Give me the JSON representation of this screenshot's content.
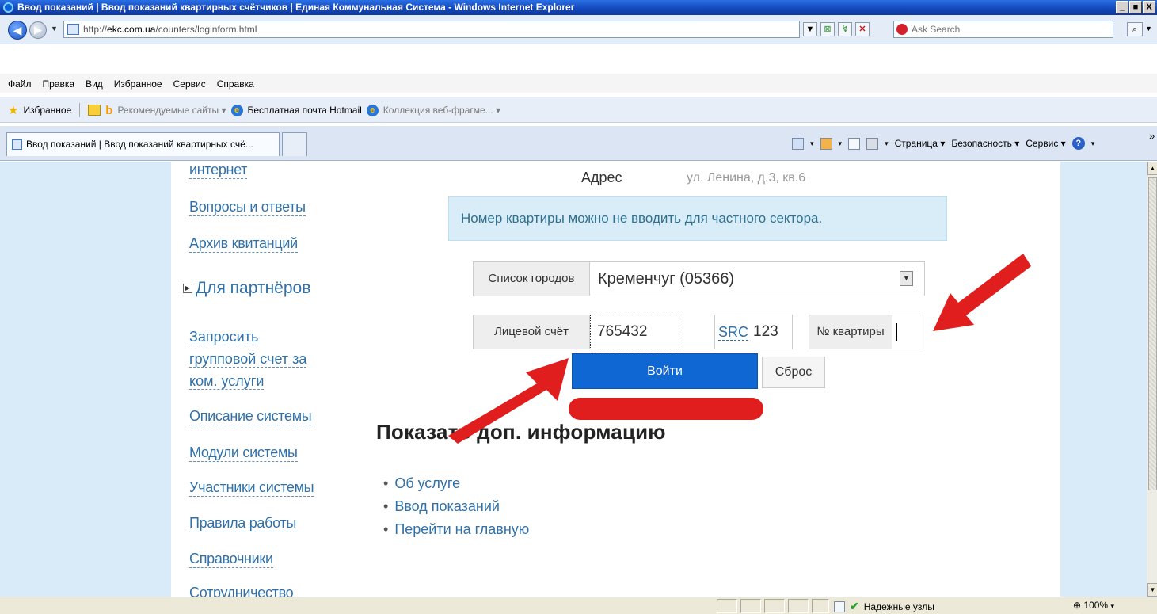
{
  "window": {
    "title": "Ввод показаний | Ввод показаний квартирных счётчиков | Единая Коммунальная Система - Windows Internet Explorer",
    "controls": [
      "_",
      "■",
      "X"
    ]
  },
  "address": {
    "url_prefix": "http://",
    "url_domain": "ekc.com.ua",
    "url_path": "/counters/loginform.html",
    "search_placeholder": "Ask Search"
  },
  "menu": [
    "Файл",
    "Правка",
    "Вид",
    "Избранное",
    "Сервис",
    "Справка"
  ],
  "favorites": {
    "label": "Избранное",
    "items": [
      "Рекомендуемые сайты ▾",
      "Бесплатная почта Hotmail",
      "Коллекция веб-фрагме... ▾"
    ]
  },
  "tab": {
    "title": "Ввод показаний | Ввод показаний квартирных счё..."
  },
  "command_bar": {
    "page": "Страница ▾",
    "security": "Безопасность ▾",
    "tools": "Сервис ▾",
    "chevron": "»"
  },
  "sidebar": {
    "links_top": [
      "интернет",
      "Вопросы и ответы",
      "Архив квитанций"
    ],
    "partners_heading": "Для партнёров",
    "partner_request": [
      "Запросить",
      "групповой счет за",
      "ком. услуги"
    ],
    "links_bottom": [
      "Описание системы",
      "Модули системы",
      "Участники системы",
      "Правила работы",
      "Справочники",
      "Сотрудничество"
    ]
  },
  "form": {
    "address_label": "Адрес",
    "address_value": "ул. Ленина, д.3, кв.6",
    "info": "Номер квартиры можно не вводить для частного сектора.",
    "city_label": "Список городов",
    "city_value": "Кременчуг (05366)",
    "account_label": "Лицевой счёт",
    "account_value": "765432",
    "src_label": "SRC",
    "src_value": "123",
    "apartment_label": "№ квартиры",
    "apartment_value": "",
    "login_button": "Войти",
    "reset_button": "Сброс"
  },
  "more": {
    "heading": "Показать доп. информацию",
    "links": [
      "Об услуге",
      "Ввод показаний",
      "Перейти на главную"
    ]
  },
  "status": {
    "zone": "Надежные узлы",
    "zoom": "100%"
  },
  "colors": {
    "link": "#3071a9",
    "login_button": "#0f67d3",
    "annotation_red": "#e01e1e",
    "info_bg": "#d8edf7"
  }
}
